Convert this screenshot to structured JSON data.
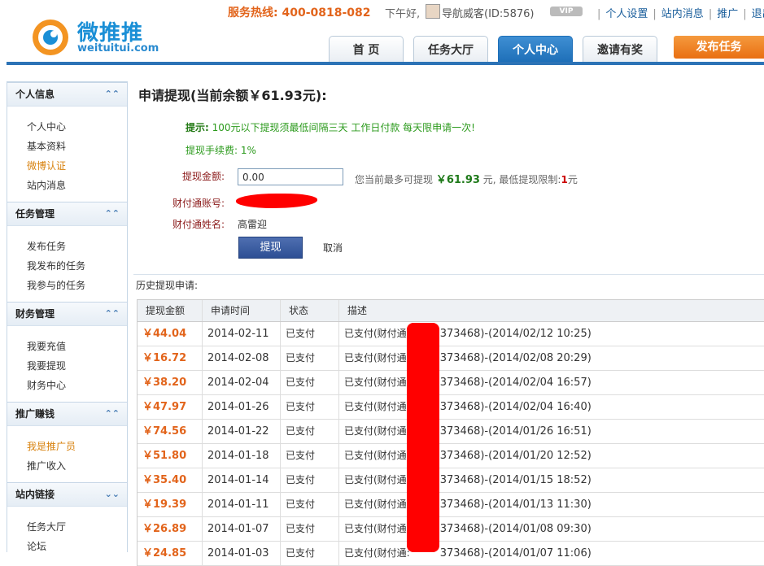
{
  "header": {
    "logo_cn": "微推推",
    "logo_en": "weituitui.com",
    "hotline": "服务热线: 400-0818-082",
    "greeting": "下午好,",
    "user": "导航威客(ID:5876)",
    "vip": "VIP",
    "links": [
      "个人设置",
      "站内消息",
      "推广",
      "退出"
    ]
  },
  "nav": {
    "tabs": [
      {
        "label": "首 页"
      },
      {
        "label": "任务大厅"
      },
      {
        "label": "个人中心"
      },
      {
        "label": "邀请有奖"
      }
    ],
    "publish": "发布任务"
  },
  "sidebar": {
    "sections": [
      {
        "title": "个人信息",
        "items": [
          "个人中心",
          "基本资料",
          "微博认证",
          "站内消息"
        ]
      },
      {
        "title": "任务管理",
        "items": [
          "发布任务",
          "我发布的任务",
          "我参与的任务"
        ]
      },
      {
        "title": "财务管理",
        "items": [
          "我要充值",
          "我要提现",
          "财务中心"
        ]
      },
      {
        "title": "推广赚钱",
        "items": [
          "我是推广员",
          "推广收入"
        ]
      },
      {
        "title": "站内链接",
        "items": [
          "任务大厅",
          "论坛"
        ]
      }
    ]
  },
  "form": {
    "title": "申请提现(当前余额￥61.93元):",
    "tip_label": "提示:",
    "tip_text": "100元以下提现须最低间隔三天 工作日付款 每天限申请一次!",
    "fee": "提现手续费: 1%",
    "amount_label": "提现金额:",
    "amount_value": "0.00",
    "max_prefix": "您当前最多可提现",
    "max_value": "￥61.93",
    "max_mid": "元, 最低提现限制:",
    "min_value": "1",
    "max_suffix": "元",
    "account_label": "财付通账号:",
    "name_label": "财付通姓名:",
    "name_value": "高雷迎",
    "submit": "提现",
    "cancel": "取消"
  },
  "history": {
    "title": "历史提现申请:",
    "columns": [
      "提现金额",
      "申请时间",
      "状态",
      "描述"
    ],
    "rows": [
      {
        "amount": "￥44.04",
        "date": "2014-02-11",
        "status": "已支付",
        "desc_a": "已支付(财付通:",
        "desc_b": "373468)-(2014/02/12 10:25)"
      },
      {
        "amount": "￥16.72",
        "date": "2014-02-08",
        "status": "已支付",
        "desc_a": "已支付(财付通:",
        "desc_b": "373468)-(2014/02/08 20:29)"
      },
      {
        "amount": "￥38.20",
        "date": "2014-02-04",
        "status": "已支付",
        "desc_a": "已支付(财付通:",
        "desc_b": "373468)-(2014/02/04 16:57)"
      },
      {
        "amount": "￥47.97",
        "date": "2014-01-26",
        "status": "已支付",
        "desc_a": "已支付(财付通:",
        "desc_b": "373468)-(2014/02/04 16:40)"
      },
      {
        "amount": "￥74.56",
        "date": "2014-01-22",
        "status": "已支付",
        "desc_a": "已支付(财付通:",
        "desc_b": "373468)-(2014/01/26 16:51)"
      },
      {
        "amount": "￥51.80",
        "date": "2014-01-18",
        "status": "已支付",
        "desc_a": "已支付(财付通:",
        "desc_b": "373468)-(2014/01/20 12:52)"
      },
      {
        "amount": "￥35.40",
        "date": "2014-01-14",
        "status": "已支付",
        "desc_a": "已支付(财付通:",
        "desc_b": "373468)-(2014/01/15 18:52)"
      },
      {
        "amount": "￥19.39",
        "date": "2014-01-11",
        "status": "已支付",
        "desc_a": "已支付(财付通:",
        "desc_b": "373468)-(2014/01/13 11:30)"
      },
      {
        "amount": "￥26.89",
        "date": "2014-01-07",
        "status": "已支付",
        "desc_a": "已支付(财付通:",
        "desc_b": "373468)-(2014/01/08 09:30)"
      },
      {
        "amount": "￥24.85",
        "date": "2014-01-03",
        "status": "已支付",
        "desc_a": "已支付(财付通:",
        "desc_b": "373468)-(2014/01/07 11:06)"
      }
    ]
  }
}
